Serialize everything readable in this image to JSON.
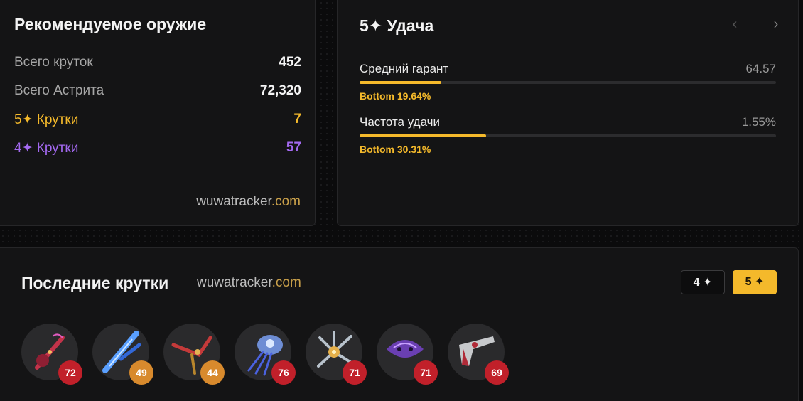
{
  "weapon": {
    "title": "Рекомендуемое оружие",
    "stats": [
      {
        "label": "Всего круток",
        "value": "452"
      },
      {
        "label": "Всего Астрита",
        "value": "72,320"
      },
      {
        "label": "5✦ Крутки",
        "value": "7"
      },
      {
        "label": "4✦ Крутки",
        "value": "57"
      }
    ],
    "brand_main": "wuwatracker",
    "brand_tld": ".com"
  },
  "luck": {
    "title": "5✦ Удача",
    "prev_icon": "‹",
    "next_icon": "›",
    "metrics": [
      {
        "name": "Средний гарант",
        "value": "64.57",
        "sub": "Bottom 19.64%",
        "fill_fraction": 0.197
      },
      {
        "name": "Частота удачи",
        "value": "1.55%",
        "sub": "Bottom 30.31%",
        "fill_fraction": 0.303
      }
    ]
  },
  "recent": {
    "title": "Последние крутки",
    "brand_main": "wuwatracker",
    "brand_tld": ".com",
    "filters": [
      {
        "label": "4 ✦",
        "active": false
      },
      {
        "label": "5 ✦",
        "active": true
      }
    ],
    "pulls": [
      {
        "icon": "crimson-violin-weapon-icon",
        "pity": "72",
        "badge_color": "#c1202a"
      },
      {
        "icon": "blue-crystal-sword-weapon-icon",
        "pity": "49",
        "badge_color": "#d88a2d"
      },
      {
        "icon": "red-gold-blade-weapon-icon",
        "pity": "44",
        "badge_color": "#d88a2d"
      },
      {
        "icon": "jellyfish-weapon-icon",
        "pity": "76",
        "badge_color": "#c1202a"
      },
      {
        "icon": "silver-shard-weapon-icon",
        "pity": "71",
        "badge_color": "#c1202a"
      },
      {
        "icon": "purple-mask-weapon-icon",
        "pity": "71",
        "badge_color": "#c1202a"
      },
      {
        "icon": "red-pistol-weapon-icon",
        "pity": "69",
        "badge_color": "#c1202a"
      }
    ]
  },
  "colors": {
    "accent": "#f4b92b",
    "purple": "#a369f0",
    "card_bg": "#141415"
  }
}
